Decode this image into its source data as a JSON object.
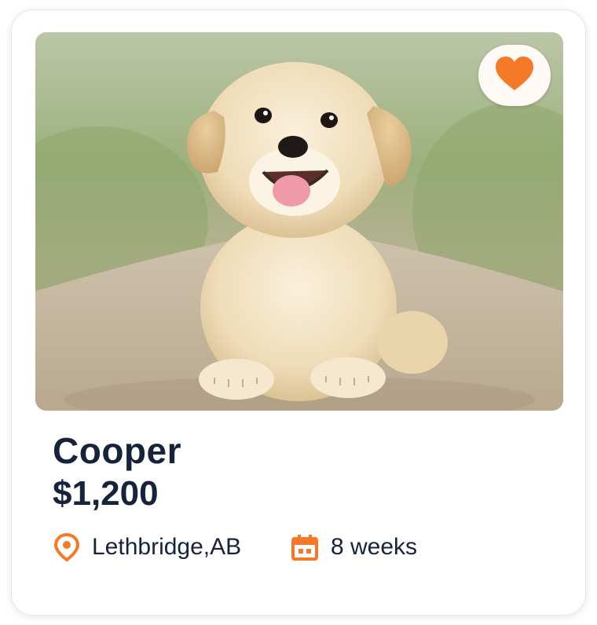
{
  "listing": {
    "name": "Cooper",
    "price": "$1,200",
    "location": "Lethbridge,AB",
    "age": "8 weeks",
    "photo_subject": "golden retriever puppy",
    "favorited": true
  },
  "icons": {
    "favorite": "heart-icon",
    "location": "map-pin-icon",
    "age": "calendar-icon"
  },
  "colors": {
    "accent": "#f47a2a",
    "text": "#17233a",
    "card_background": "#ffffff"
  }
}
